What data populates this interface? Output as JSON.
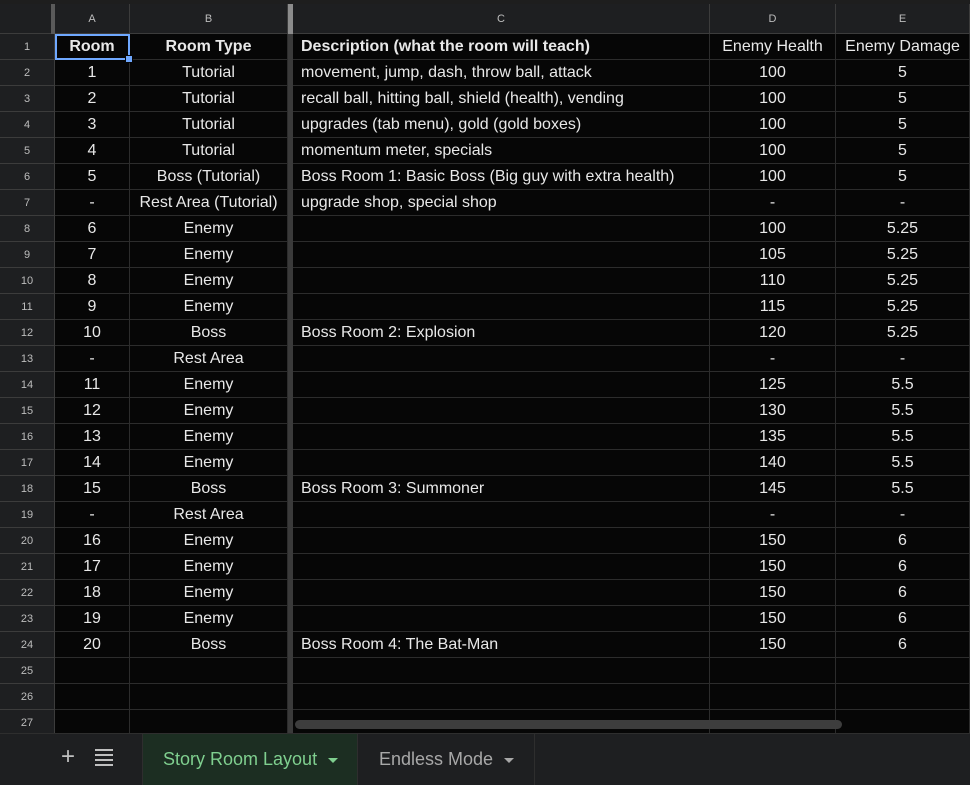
{
  "columns": {
    "A": "A",
    "B": "B",
    "C": "C",
    "D": "D",
    "E": "E"
  },
  "header_row": {
    "room": "Room",
    "room_type": "Room Type",
    "description": "Description (what the room will teach)",
    "enemy_health": "Enemy Health",
    "enemy_damage": "Enemy Damage"
  },
  "rows": [
    {
      "num": "1"
    },
    {
      "num": "2",
      "room": "1",
      "type": "Tutorial",
      "desc": "movement, jump, dash, throw ball, attack",
      "health": "100",
      "damage": "5"
    },
    {
      "num": "3",
      "room": "2",
      "type": "Tutorial",
      "desc": "recall ball, hitting ball, shield (health), vending",
      "health": "100",
      "damage": "5"
    },
    {
      "num": "4",
      "room": "3",
      "type": "Tutorial",
      "desc": "upgrades (tab menu), gold (gold boxes)",
      "health": "100",
      "damage": "5"
    },
    {
      "num": "5",
      "room": "4",
      "type": "Tutorial",
      "desc": "momentum meter, specials",
      "health": "100",
      "damage": "5"
    },
    {
      "num": "6",
      "room": "5",
      "type": "Boss (Tutorial)",
      "desc": "Boss Room 1: Basic Boss (Big guy with extra health)",
      "health": "100",
      "damage": "5"
    },
    {
      "num": "7",
      "room": "-",
      "type": "Rest Area (Tutorial)",
      "desc": "upgrade shop, special shop",
      "health": "-",
      "damage": "-"
    },
    {
      "num": "8",
      "room": "6",
      "type": "Enemy",
      "desc": "",
      "health": "100",
      "damage": "5.25"
    },
    {
      "num": "9",
      "room": "7",
      "type": "Enemy",
      "desc": "",
      "health": "105",
      "damage": "5.25"
    },
    {
      "num": "10",
      "room": "8",
      "type": "Enemy",
      "desc": "",
      "health": "110",
      "damage": "5.25"
    },
    {
      "num": "11",
      "room": "9",
      "type": "Enemy",
      "desc": "",
      "health": "115",
      "damage": "5.25"
    },
    {
      "num": "12",
      "room": "10",
      "type": "Boss",
      "desc": "Boss Room 2: Explosion",
      "health": "120",
      "damage": "5.25"
    },
    {
      "num": "13",
      "room": "-",
      "type": "Rest Area",
      "desc": "",
      "health": "-",
      "damage": "-"
    },
    {
      "num": "14",
      "room": "11",
      "type": "Enemy",
      "desc": "",
      "health": "125",
      "damage": "5.5"
    },
    {
      "num": "15",
      "room": "12",
      "type": "Enemy",
      "desc": "",
      "health": "130",
      "damage": "5.5"
    },
    {
      "num": "16",
      "room": "13",
      "type": "Enemy",
      "desc": "",
      "health": "135",
      "damage": "5.5"
    },
    {
      "num": "17",
      "room": "14",
      "type": "Enemy",
      "desc": "",
      "health": "140",
      "damage": "5.5"
    },
    {
      "num": "18",
      "room": "15",
      "type": "Boss",
      "desc": "Boss Room 3: Summoner",
      "health": "145",
      "damage": "5.5"
    },
    {
      "num": "19",
      "room": "-",
      "type": "Rest Area",
      "desc": "",
      "health": "-",
      "damage": "-"
    },
    {
      "num": "20",
      "room": "16",
      "type": "Enemy",
      "desc": "",
      "health": "150",
      "damage": "6"
    },
    {
      "num": "21",
      "room": "17",
      "type": "Enemy",
      "desc": "",
      "health": "150",
      "damage": "6"
    },
    {
      "num": "22",
      "room": "18",
      "type": "Enemy",
      "desc": "",
      "health": "150",
      "damage": "6"
    },
    {
      "num": "23",
      "room": "19",
      "type": "Enemy",
      "desc": "",
      "health": "150",
      "damage": "6"
    },
    {
      "num": "24",
      "room": "20",
      "type": "Boss",
      "desc": "Boss Room 4: The Bat-Man",
      "health": "150",
      "damage": "6"
    },
    {
      "num": "25",
      "room": "",
      "type": "",
      "desc": "",
      "health": "",
      "damage": ""
    },
    {
      "num": "26",
      "room": "",
      "type": "",
      "desc": "",
      "health": "",
      "damage": ""
    },
    {
      "num": "27",
      "room": "",
      "type": "",
      "desc": "",
      "health": "",
      "damage": ""
    }
  ],
  "tabs": {
    "add_icon": "plus-icon",
    "all_sheets_icon": "list-icon",
    "active": "Story Room Layout",
    "inactive": "Endless Mode"
  },
  "colors": {
    "background": "#060606",
    "header_bg": "#1e1f21",
    "active_tab_text": "#7fcf8f",
    "selection": "#6fa8ff"
  }
}
